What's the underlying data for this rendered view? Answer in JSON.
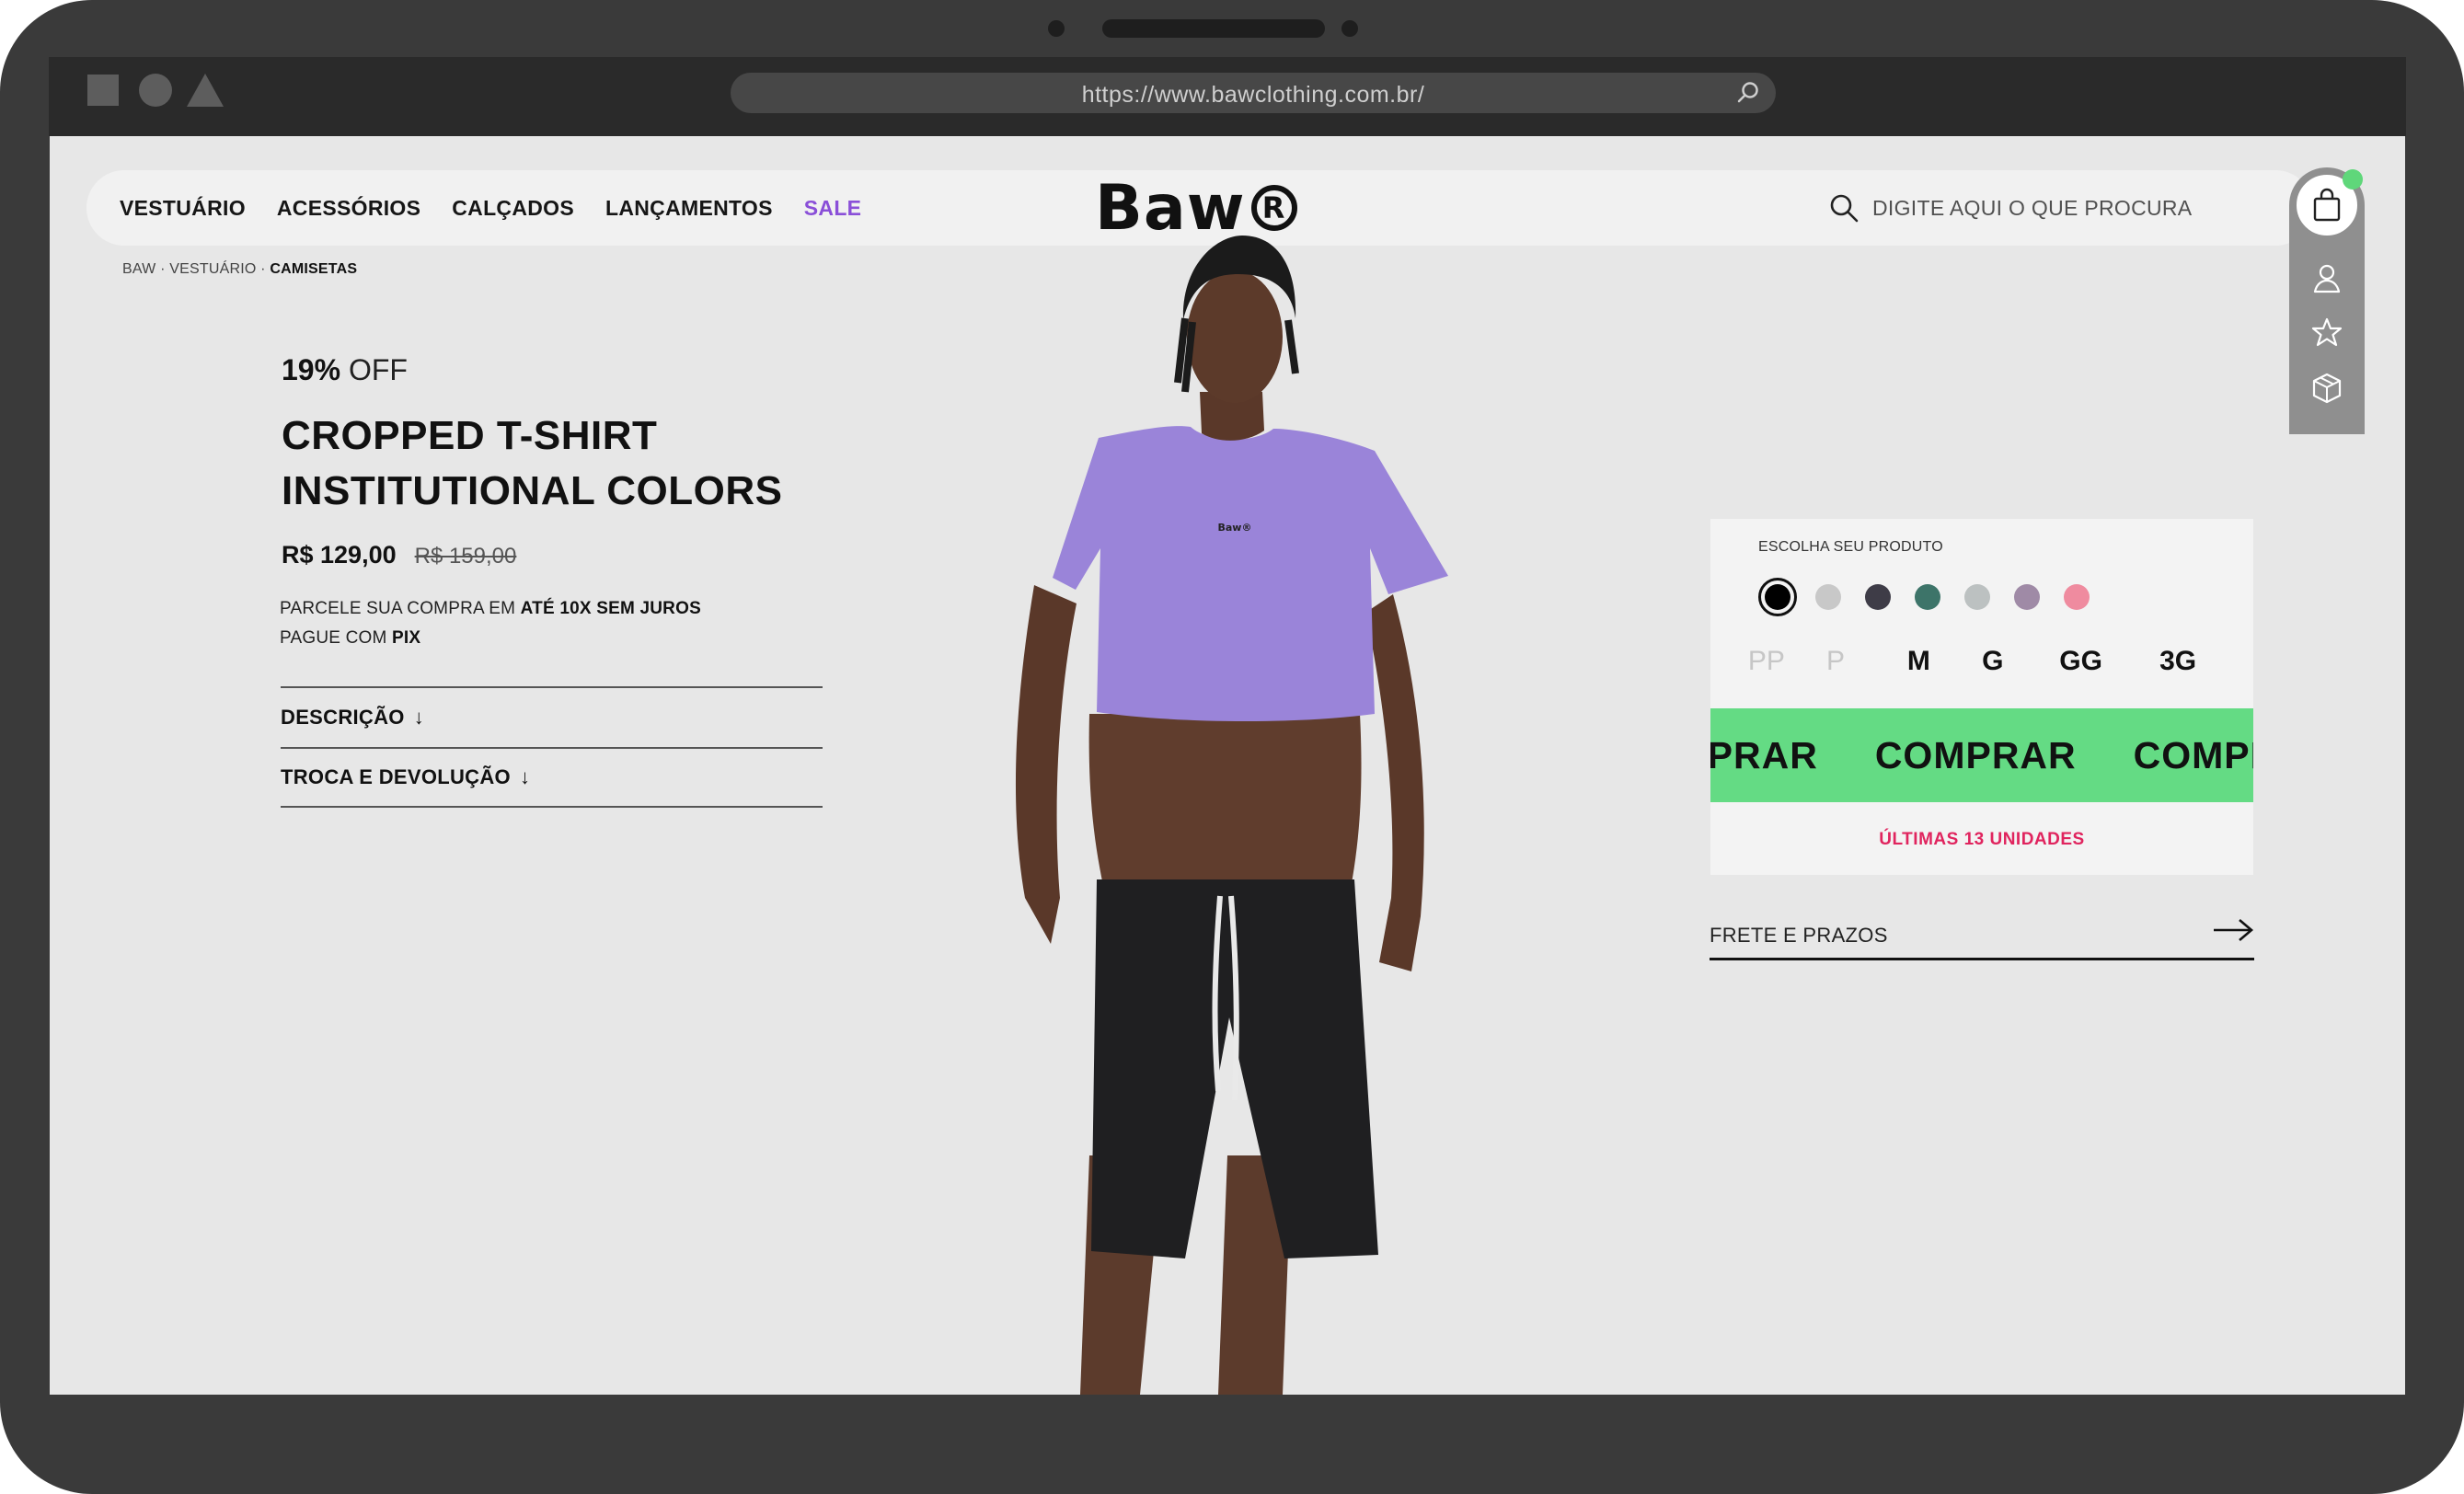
{
  "browser": {
    "url": "https://www.bawclothing.com.br/"
  },
  "header": {
    "nav": [
      "VESTUÁRIO",
      "ACESSÓRIOS",
      "CALÇADOS",
      "LANÇAMENTOS"
    ],
    "sale": "SALE",
    "logo": "Baw",
    "logo_mark": "R",
    "search_placeholder": "DIGITE AQUI O QUE PROCURA"
  },
  "breadcrumb": {
    "path": "BAW · VESTUÁRIO · ",
    "current": "CAMISETAS"
  },
  "product": {
    "discount_value": "19%",
    "discount_label": " OFF",
    "title_line1": "CROPPED T-SHIRT",
    "title_line2": "INSTITUTIONAL COLORS",
    "price": "R$ 129,00",
    "old_price": "R$ 159,00",
    "installments_prefix": "PARCELE SUA COMPRA EM ",
    "installments_bold": "ATÉ 10X SEM JUROS",
    "pix_prefix": "PAGUE COM ",
    "pix_bold": "PIX",
    "accordion": [
      "DESCRIÇÃO",
      "TROCA E DEVOLUÇÃO"
    ],
    "shirt_logo": "Baw®"
  },
  "options": {
    "label": "ESCOLHA SEU PRODUTO",
    "colors": [
      "#000000",
      "#c8c8c8",
      "#3e3c47",
      "#3d7469",
      "#bcc1c1",
      "#9f8aa6",
      "#ef8b9f"
    ],
    "selected_color_index": 0,
    "sizes": [
      "PP",
      "P",
      "M",
      "G",
      "GG",
      "3G"
    ],
    "sizes_available": [
      false,
      false,
      true,
      true,
      true,
      true
    ],
    "buy_label": "COMPRAR",
    "stock_message": "ÚLTIMAS 13 UNIDADES"
  },
  "shipping": {
    "label": "FRETE E PRAZOS"
  },
  "colors": {
    "accent_green": "#64db84",
    "sale_purple": "#8a4fd8",
    "stock_red": "#e0245e"
  }
}
